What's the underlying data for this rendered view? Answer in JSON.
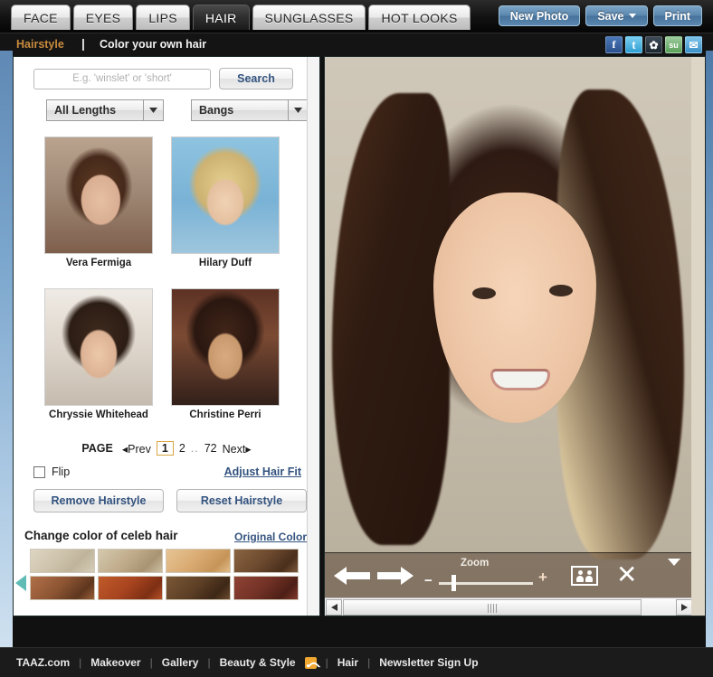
{
  "header": {
    "tabs": [
      {
        "label": "FACE",
        "active": false
      },
      {
        "label": "EYES",
        "active": false
      },
      {
        "label": "LIPS",
        "active": false
      },
      {
        "label": "HAIR",
        "active": true
      },
      {
        "label": "SUNGLASSES",
        "active": false
      },
      {
        "label": "HOT LOOKS",
        "active": false
      }
    ],
    "buttons": {
      "new_photo": "New Photo",
      "save": "Save",
      "print": "Print"
    }
  },
  "subbar": {
    "breadcrumb_link": "Hairstyle",
    "separator": "|",
    "title": "Color your own hair",
    "social": [
      {
        "name": "facebook-icon",
        "glyph": "f"
      },
      {
        "name": "twitter-icon",
        "glyph": "t"
      },
      {
        "name": "myspace-icon",
        "glyph": "✿"
      },
      {
        "name": "stumbleupon-icon",
        "glyph": "su"
      },
      {
        "name": "email-icon",
        "glyph": "✉"
      }
    ]
  },
  "search": {
    "value": "",
    "placeholder": "E.g. 'winslet' or 'short'",
    "button_label": "Search"
  },
  "filters": [
    {
      "name": "length-select",
      "value": "All Lengths"
    },
    {
      "name": "bangs-select",
      "value": "Bangs"
    }
  ],
  "thumbnails": [
    {
      "name": "Vera Fermiga",
      "swatch": "ph1"
    },
    {
      "name": "Hilary Duff",
      "swatch": "ph2"
    },
    {
      "name": "Chryssie Whitehead",
      "swatch": "ph3"
    },
    {
      "name": "Christine Perri",
      "swatch": "ph4"
    }
  ],
  "pagination": {
    "label": "PAGE",
    "prev": "◂Prev",
    "pages": [
      "1",
      "2"
    ],
    "current": "1",
    "dots": "..",
    "last": "72",
    "next": "Next▸"
  },
  "options": {
    "flip_label": "Flip",
    "flip_checked": false,
    "adjust_link": "Adjust Hair Fit",
    "remove_button": "Remove Hairstyle",
    "reset_button": "Reset Hairstyle"
  },
  "color_section": {
    "title": "Change color of celeb hair",
    "original_link": "Original Color",
    "swatches": [
      {
        "name": "swatch-platinum-blonde",
        "color": "#cfc4ad"
      },
      {
        "name": "swatch-ash-blonde",
        "color": "#c0ab8b"
      },
      {
        "name": "swatch-golden-blonde",
        "color": "#d9ab72"
      },
      {
        "name": "swatch-dark-brown",
        "color": "#6d4a2f"
      },
      {
        "name": "swatch-auburn",
        "color": "#8d5533"
      },
      {
        "name": "swatch-copper-red",
        "color": "#a8441f"
      },
      {
        "name": "swatch-medium-brown",
        "color": "#5e4026"
      },
      {
        "name": "swatch-dark-red",
        "color": "#733226"
      }
    ],
    "prev_arrow": "◀",
    "next_arrow": "▶"
  },
  "photo_tools": {
    "back_label": "back-arrow",
    "forward_label": "forward-arrow",
    "zoom_label": "Zoom",
    "zoom_minus": "−",
    "zoom_plus": "+",
    "compare_icon": "compare-faces-icon",
    "close_icon": "✕",
    "collapse_icon": "▼"
  },
  "footer": {
    "links": [
      "TAAZ.com",
      "Makeover",
      "Gallery",
      "Beauty & Style",
      "Hair",
      "Newsletter Sign Up"
    ],
    "separator": "|",
    "rss_icon": "rss-icon"
  }
}
